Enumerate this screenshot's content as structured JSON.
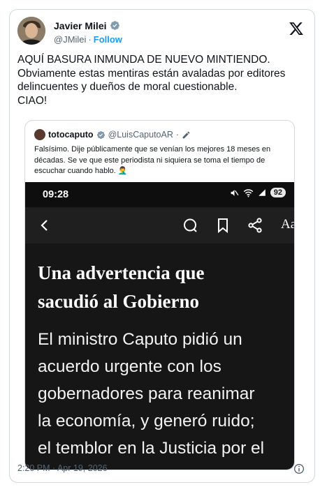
{
  "tweet": {
    "author_name": "Javier Milei",
    "author_handle": "@JMilei",
    "separator": "·",
    "follow_label": "Follow",
    "text_lines": [
      "AQUÍ BASURA INMUNDA DE NUEVO MINTIENDO.",
      "Obviamente estas mentiras están avaladas por editores",
      "delincuentes y dueños de moral cuestionable.",
      "CIAO!"
    ],
    "timestamp": "2:20 PM · Apr 19, 2026"
  },
  "quote": {
    "author_name": "totocaputo",
    "author_handle": "@LuisCaputoAR",
    "separator": "·",
    "text_lines": [
      "Falsísimo. Dije públicamente que se venían los mejores 18 meses en",
      "décadas. Se ve que este periodista ni siquiera se toma el tiempo de",
      "escuchar cuando hablo. 🤦‍♂️"
    ]
  },
  "screenshot": {
    "time": "09:28",
    "battery": "92",
    "toolbar_text_size_label": "Aa",
    "headline_lines": [
      "Una advertencia que",
      "sacudió al Gobierno"
    ],
    "body_lines": [
      "El ministro Caputo pidió un",
      "acuerdo urgente con los",
      "gobernadores para reanimar",
      "la economía, y generó ruido;",
      "el temblor en la Justicia por el"
    ]
  },
  "colors": {
    "link": "#1d9bf0",
    "verified": "#829aab",
    "muted": "#536471",
    "border": "#cfd9de"
  },
  "icons": [
    "verified-badge-icon",
    "x-logo-icon",
    "edit-icon",
    "back-arrow-icon",
    "search-icon",
    "bookmark-icon",
    "share-icon",
    "mute-icon",
    "wifi-icon",
    "signal-icon",
    "info-icon"
  ]
}
